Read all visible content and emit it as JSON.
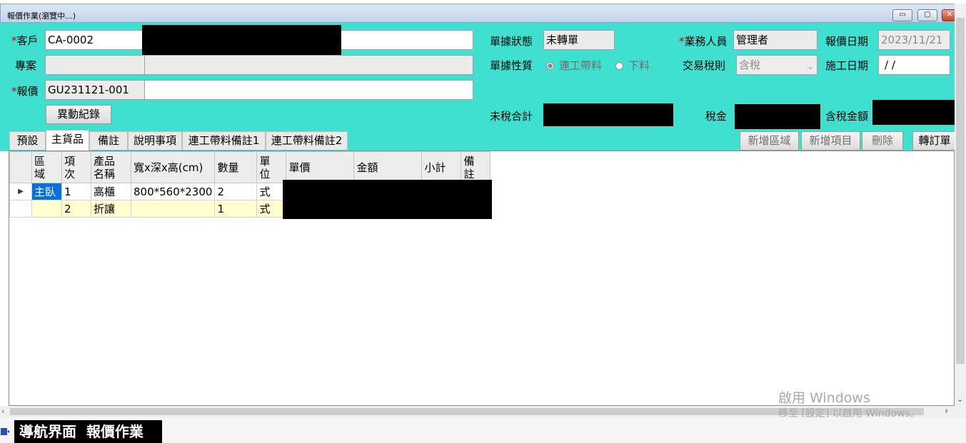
{
  "window": {
    "title": "報價作業(瀏覽中...)",
    "minimize": "▭",
    "maximize": "▢",
    "close": "✕"
  },
  "header": {
    "customer_label": "客戶",
    "customer_code": "CA-0002",
    "project_label": "專案",
    "project_code": "",
    "project_name": "",
    "quote_label": "報價",
    "quote_no": "GU231121-001",
    "quote_desc": "",
    "history_button": "異動紀錄",
    "doc_status_label": "單據狀態",
    "doc_status": "未轉單",
    "doc_type_label": "單據性質",
    "doc_type_options": [
      "連工帶料",
      "下料"
    ],
    "doc_type_selected": 0,
    "sales_label": "業務人員",
    "sales_person": "管理者",
    "tax_rule_label": "交易稅則",
    "tax_rule": "含稅",
    "quote_date_label": "報價日期",
    "quote_date": "2023/11/21",
    "work_date_label": "施工日期",
    "work_date": " / /",
    "pretax_label": "未稅合計",
    "tax_label": "稅金",
    "total_label": "含稅金額",
    "required_mark": "*"
  },
  "tabs": [
    "預設",
    "主貨品",
    "備註",
    "說明事項",
    "連工帶料備註1",
    "連工帶料備註2"
  ],
  "active_tab": 1,
  "actions": {
    "add_area": "新增區域",
    "add_item": "新增項目",
    "delete": "刪除",
    "convert": "轉訂單"
  },
  "grid": {
    "columns": [
      "區域",
      "項次",
      "產品名稱",
      "寬x深x高(cm)",
      "數量",
      "單位",
      "單價",
      "金額",
      "小計",
      "備註"
    ],
    "column_lines": [
      [
        "區",
        "域"
      ],
      [
        "項",
        "次"
      ],
      [
        "產品",
        "名稱"
      ],
      [
        "寬x深x高(cm)"
      ],
      [
        "數量"
      ],
      [
        "單",
        "位"
      ],
      [
        "單價"
      ],
      [
        "金額"
      ],
      [
        "小計"
      ],
      [
        "備",
        "註"
      ]
    ],
    "rows": [
      {
        "area": "主臥",
        "no": "1",
        "name": "高櫃",
        "dim": "800*560*2300",
        "qty": "2",
        "unit": "式"
      },
      {
        "area": "",
        "no": "2",
        "name": "折讓",
        "dim": "",
        "qty": "1",
        "unit": "式"
      }
    ],
    "row_indicator": "▶"
  },
  "watermark": {
    "line1": "啟用 Windows",
    "line2": "移至 [設定] 以啟用 Windows。"
  },
  "footer": {
    "nav": "導航界面",
    "current": "報價作業"
  },
  "colors": {
    "panel": "#40e0d0",
    "selected": "#0a6fd6",
    "row_highlight": "#ffffd0"
  }
}
